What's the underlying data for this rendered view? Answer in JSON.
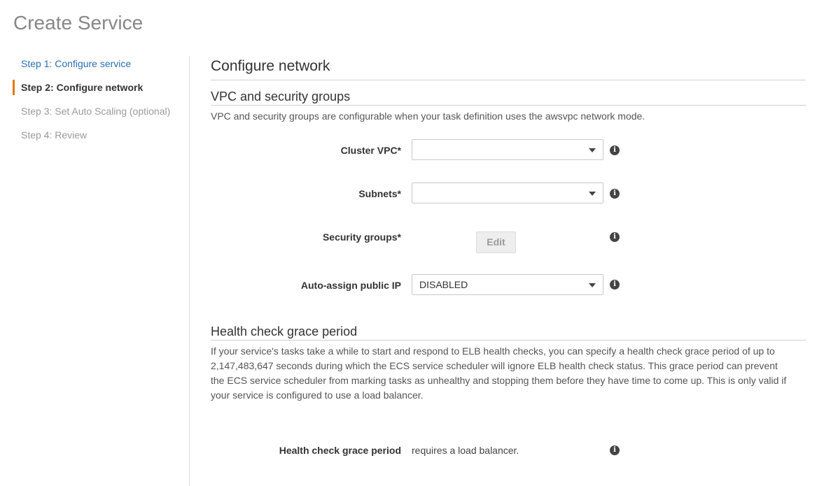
{
  "page": {
    "title": "Create Service"
  },
  "steps": [
    {
      "label": "Step 1: Configure service"
    },
    {
      "label": "Step 2: Configure network"
    },
    {
      "label": "Step 3: Set Auto Scaling (optional)"
    },
    {
      "label": "Step 4: Review"
    }
  ],
  "main": {
    "heading": "Configure network",
    "vpc_section": {
      "heading": "VPC and security groups",
      "description": "VPC and security groups are configurable when your task definition uses the awsvpc network mode."
    },
    "fields": {
      "cluster_vpc": {
        "label": "Cluster VPC*",
        "value": ""
      },
      "subnets": {
        "label": "Subnets*",
        "value": ""
      },
      "security_groups": {
        "label": "Security groups*",
        "button": "Edit"
      },
      "auto_assign_ip": {
        "label": "Auto-assign public IP",
        "value": "DISABLED"
      }
    },
    "health_section": {
      "heading": "Health check grace period",
      "description_lines": [
        "If your service's tasks take a while to start and respond to ELB health checks, you can specify a health check grace period of up to",
        "2,147,483,647 seconds during which the ECS service scheduler will ignore ELB health check status. This grace period can prevent",
        "the ECS service scheduler from marking tasks as unhealthy and stopping them before they have time to come up. This is only valid if",
        "your service is configured to use a load balancer."
      ],
      "field": {
        "label": "Health check grace period",
        "value": "requires a load balancer."
      }
    },
    "info_glyph": "i"
  },
  "icons": {
    "info": "info-circle-icon",
    "dropdown": "chevron-down-icon"
  },
  "colors": {
    "accent": "#e07b00",
    "link": "#2a6fb5"
  }
}
